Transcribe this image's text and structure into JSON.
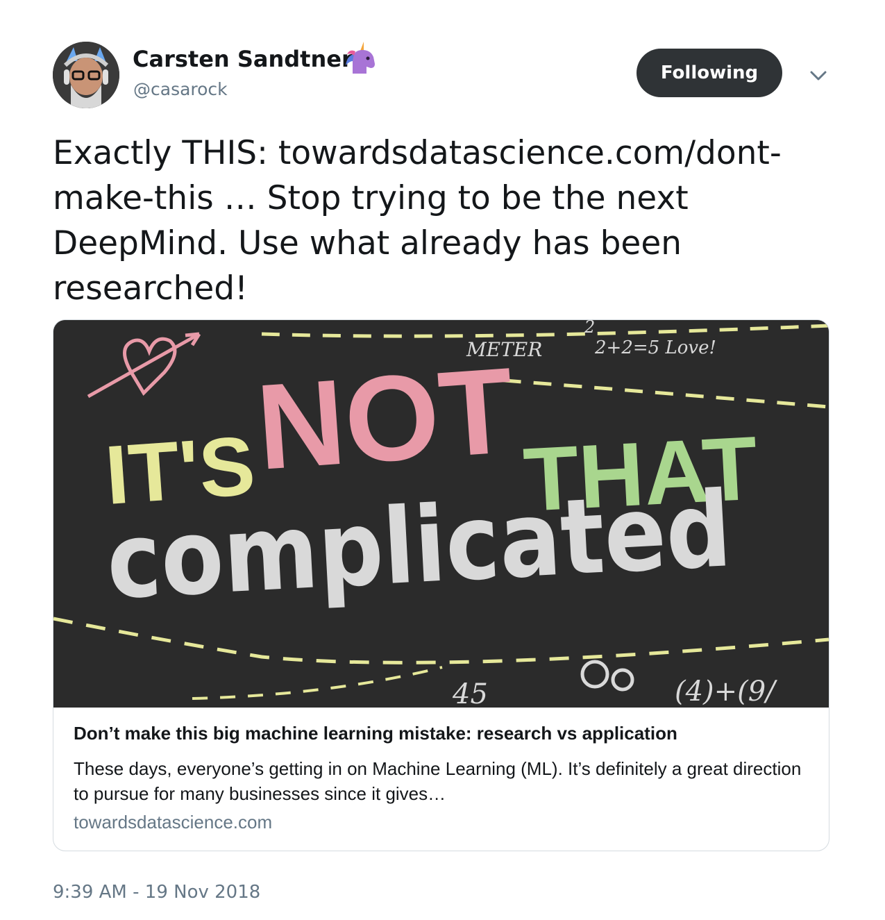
{
  "author": {
    "name": "Carsten Sandtner",
    "handle": "@casarock",
    "badge_icon": "unicorn-emoji"
  },
  "follow_button": {
    "label": "Following"
  },
  "menu": {
    "icon": "chevron-down-icon"
  },
  "tweet": {
    "text_before": "Exactly THIS: ",
    "link": "towardsdatascience.com/dont-make-this",
    "text_after": "  … Stop trying to be the next DeepMind. Use what already has been researched!"
  },
  "card": {
    "image": {
      "words": [
        "IT'S",
        "NOT",
        "THAT",
        "complicated"
      ],
      "scribbles": [
        "METER",
        "2+2=5 Love!",
        "2",
        "45",
        "(4)+(9/"
      ]
    },
    "title": "Don’t make this big machine learning mistake: research vs application",
    "description": "These days, everyone’s getting in on Machine Learning (ML). It’s definitely a great direction to pursue for many businesses since it gives…",
    "domain": "towardsdatascience.com"
  },
  "timestamp": "9:39 AM - 19 Nov 2018",
  "colors": {
    "follow_button_bg": "#2f3336",
    "secondary_text": "#657786",
    "chalkboard": "#2b2b2b",
    "chalk_pink": "#e89aa8",
    "chalk_yellow": "#e6e89a",
    "chalk_green": "#a9d68e",
    "chalk_white": "#d9d9d9"
  }
}
